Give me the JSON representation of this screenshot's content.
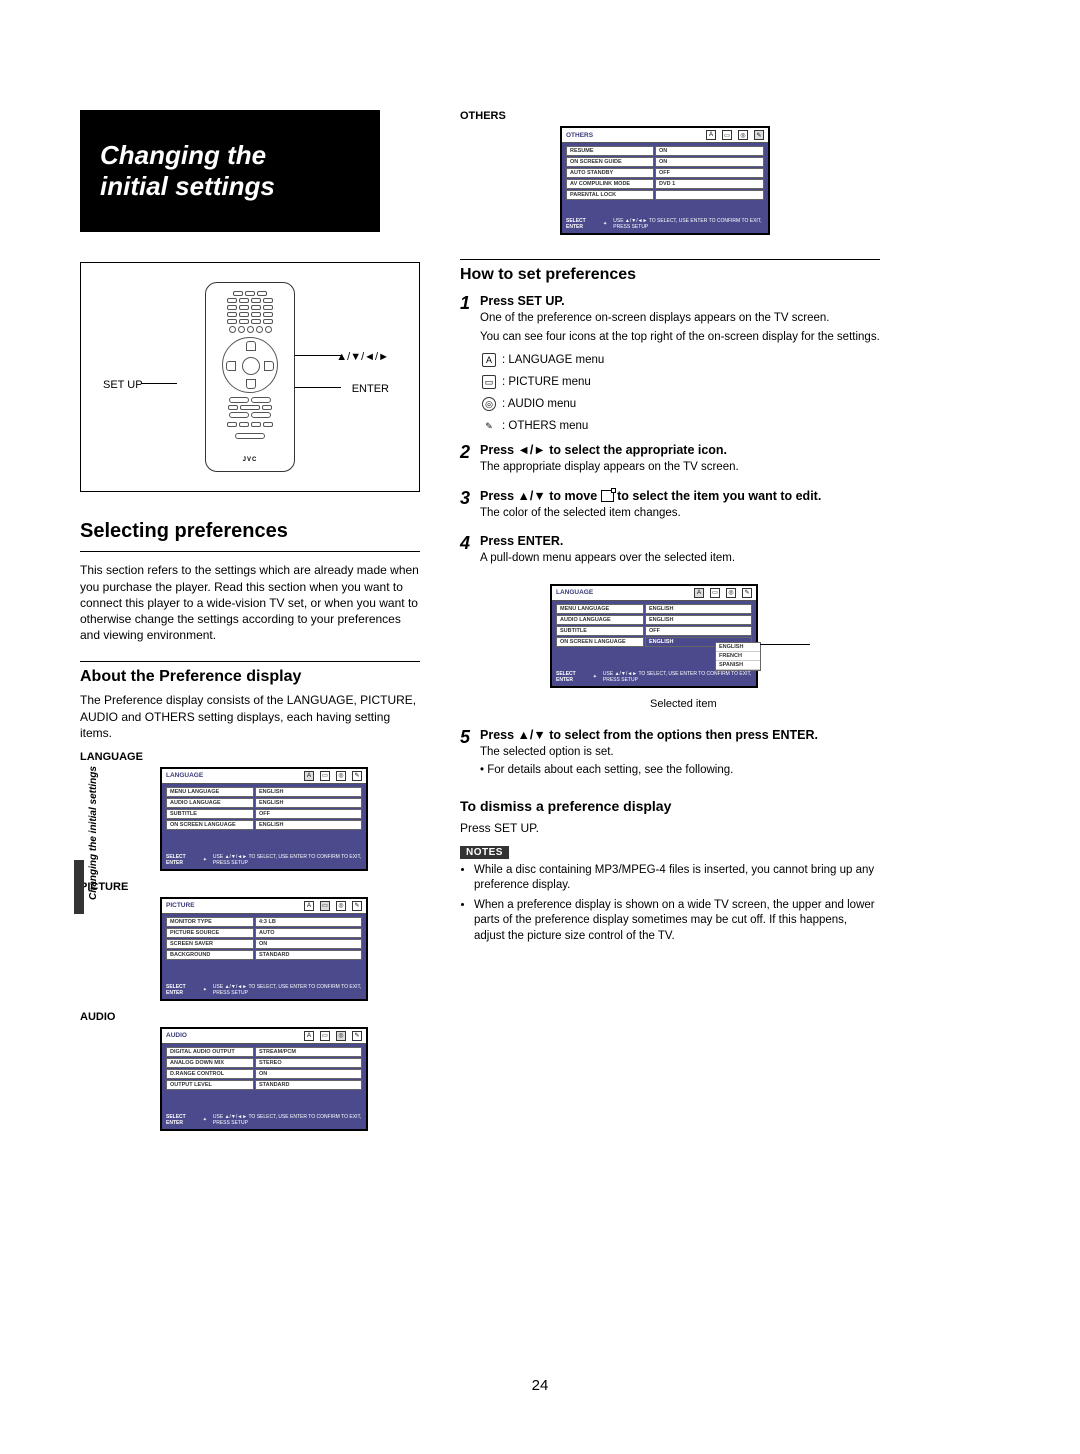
{
  "title_line1": "Changing the",
  "title_line2": "initial settings",
  "remote": {
    "label_setup": "SET UP",
    "label_arrows": "▲/▼/◄/►",
    "label_enter": "ENTER",
    "brand": "JVC"
  },
  "left": {
    "h_selecting": "Selecting preferences",
    "p_selecting": "This section refers to the settings which are already made when you purchase the player. Read this section when you want to connect this player to a wide-vision TV set, or when you want to otherwise change the settings according to your preferences and viewing environment.",
    "h_about": "About the Preference display",
    "p_about": "The Preference display consists of the LANGUAGE, PICTURE, AUDIO and OTHERS setting displays, each having setting items.",
    "label_language": "LANGUAGE",
    "label_picture": "PICTURE",
    "label_audio": "AUDIO"
  },
  "menus": {
    "language": {
      "title": "LANGUAGE",
      "rows": [
        {
          "k": "MENU LANGUAGE",
          "v": "ENGLISH"
        },
        {
          "k": "AUDIO LANGUAGE",
          "v": "ENGLISH"
        },
        {
          "k": "SUBTITLE",
          "v": "OFF"
        },
        {
          "k": "ON SCREEN LANGUAGE",
          "v": "ENGLISH"
        }
      ],
      "help": "USE ▲/▼/◄► TO SELECT, USE ENTER TO CONFIRM\nTO EXIT, PRESS SETUP"
    },
    "picture": {
      "title": "PICTURE",
      "rows": [
        {
          "k": "MONITOR TYPE",
          "v": "4:3 LB"
        },
        {
          "k": "PICTURE SOURCE",
          "v": "AUTO"
        },
        {
          "k": "SCREEN SAVER",
          "v": "ON"
        },
        {
          "k": "BACKGROUND",
          "v": "STANDARD"
        }
      ],
      "help": "USE ▲/▼/◄► TO SELECT, USE ENTER TO CONFIRM\nTO EXIT, PRESS SETUP"
    },
    "audio": {
      "title": "AUDIO",
      "rows": [
        {
          "k": "DIGITAL AUDIO OUTPUT",
          "v": "STREAM/PCM"
        },
        {
          "k": "ANALOG DOWN MIX",
          "v": "STEREO"
        },
        {
          "k": "D.RANGE CONTROL",
          "v": "ON"
        },
        {
          "k": "OUTPUT LEVEL",
          "v": "STANDARD"
        }
      ],
      "help": "USE ▲/▼/◄► TO SELECT, USE ENTER TO CONFIRM\nTO EXIT, PRESS SETUP"
    },
    "others": {
      "title": "OTHERS",
      "rows": [
        {
          "k": "RESUME",
          "v": "ON"
        },
        {
          "k": "ON SCREEN GUIDE",
          "v": "ON"
        },
        {
          "k": "AUTO STANDBY",
          "v": "OFF"
        },
        {
          "k": "AV COMPULINK MODE",
          "v": "DVD 1"
        },
        {
          "k": "PARENTAL LOCK",
          "v": ""
        }
      ],
      "help": "USE ▲/▼/◄► TO SELECT, USE ENTER TO CONFIRM\nTO EXIT, PRESS SETUP"
    },
    "language_dropdown": {
      "title": "LANGUAGE",
      "rows": [
        {
          "k": "MENU LANGUAGE",
          "v": "ENGLISH"
        },
        {
          "k": "AUDIO LANGUAGE",
          "v": "ENGLISH"
        },
        {
          "k": "SUBTITLE",
          "v": "OFF"
        },
        {
          "k": "ON SCREEN LANGUAGE",
          "v": "ENGLISH",
          "sel": true
        }
      ],
      "dropdown": [
        "ENGLISH",
        "FRENCH",
        "SPANISH"
      ],
      "help": "USE ▲/▼/◄► TO SELECT, USE ENTER TO CONFIRM\nTO EXIT, PRESS SETUP",
      "selected_label": "Selected item"
    },
    "select_enter": "SELECT\nENTER"
  },
  "right": {
    "label_others": "OTHERS",
    "h_how": "How to set preferences",
    "steps": {
      "s1": {
        "num": "1",
        "h": "Press SET UP.",
        "p1": "One of the preference on-screen displays appears on the TV screen.",
        "p2": "You can see four icons at the top right of the on-screen display for the settings.",
        "icon_lang": ": LANGUAGE menu",
        "icon_pic": ": PICTURE menu",
        "icon_audio": ": AUDIO menu",
        "icon_others": ": OTHERS menu"
      },
      "s2": {
        "num": "2",
        "h": "Press ◄/► to select the appropriate icon.",
        "p": "The appropriate display appears on the TV screen."
      },
      "s3": {
        "num": "3",
        "h_a": "Press ▲/▼ to move ",
        "h_b": " to select the item you want to edit.",
        "p": "The color of the selected item changes."
      },
      "s4": {
        "num": "4",
        "h": "Press ENTER.",
        "p": "A pull-down menu appears over the selected item."
      },
      "s5": {
        "num": "5",
        "h": "Press ▲/▼ to select from the options then press ENTER.",
        "p1": "The selected option is set.",
        "p2": "• For details about each setting, see the following."
      }
    },
    "h_dismiss": "To dismiss a preference display",
    "p_dismiss": "Press SET UP.",
    "notes_label": "NOTES",
    "notes": [
      "While a disc containing MP3/MPEG-4 files is inserted, you cannot bring up any preference display.",
      "When a preference display is shown on a wide TV screen, the upper and lower parts of the preference display sometimes may be cut off. If this happens, adjust the picture size control of the TV."
    ]
  },
  "sidebar": "Changing the initial settings",
  "page_number": "24"
}
